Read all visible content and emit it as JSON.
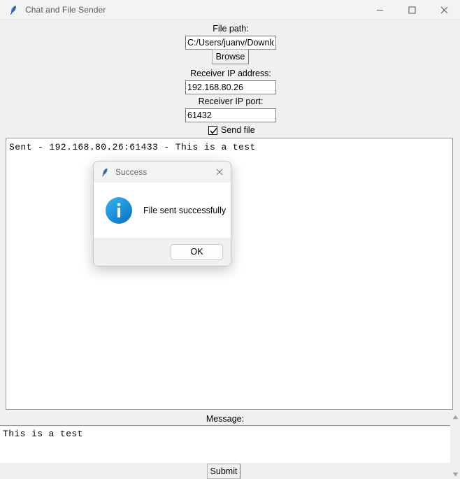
{
  "window": {
    "title": "Chat and File Sender",
    "icon": "feather-icon",
    "controls": {
      "minimize": "minimize-icon",
      "maximize": "maximize-icon",
      "close": "close-icon"
    }
  },
  "form": {
    "file_path_label": "File path:",
    "file_path_value": "C:/Users/juanv/Downlo",
    "browse_label": "Browse",
    "receiver_ip_label": "Receiver IP address:",
    "receiver_ip_value": "192.168.80.26",
    "receiver_port_label": "Receiver IP port:",
    "receiver_port_value": "61432",
    "send_file_label": "Send file",
    "send_file_checked": true
  },
  "chat_log": {
    "lines": [
      "Sent - 192.168.80.26:61433 - This is a test"
    ]
  },
  "message": {
    "label": "Message:",
    "value": "This is a test"
  },
  "bottom": {
    "submit_label": "Submit"
  },
  "dialog": {
    "title": "Success",
    "icon": "feather-icon",
    "info_icon": "info-icon",
    "message": "File sent successfully",
    "ok_label": "OK",
    "close": "close-icon",
    "accent_color": "#1a9bdd"
  }
}
